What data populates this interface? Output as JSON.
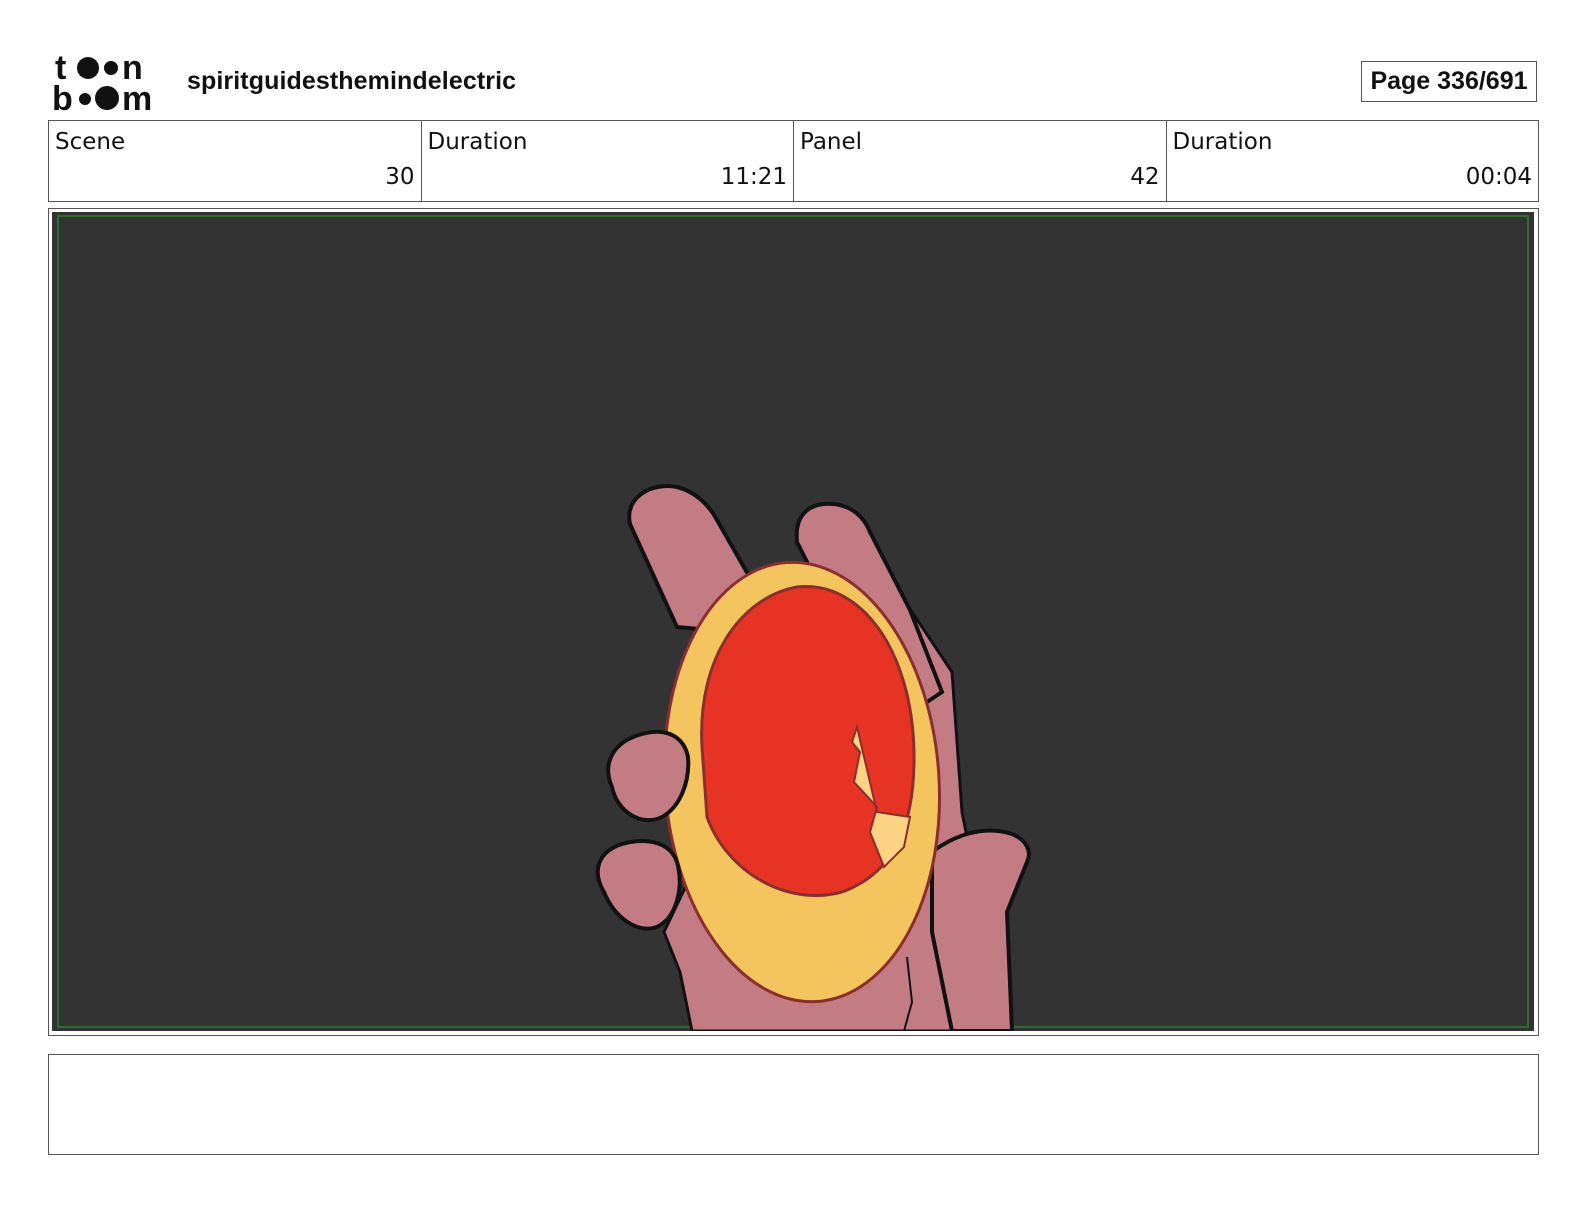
{
  "header": {
    "logo_lines": [
      "toon",
      "boom"
    ],
    "project_title": "spiritguidesthemindelectric",
    "page_label": "Page 336/691"
  },
  "info": {
    "scene_label": "Scene",
    "scene_value": "30",
    "scene_duration_label": "Duration",
    "scene_duration_value": "11:21",
    "panel_label": "Panel",
    "panel_value": "42",
    "panel_duration_label": "Duration",
    "panel_duration_value": "00:04"
  },
  "panel_image": {
    "icon": "hand-holding-egg-illustration",
    "colors": {
      "background": "#333333",
      "safe_frame": "#2e6b2e",
      "skin": "#c47c84",
      "egg_shell": "#f4c45e",
      "egg_yolk": "#e63323",
      "highlight": "#fbd383",
      "outline": "#111111"
    }
  },
  "notes": {
    "text": ""
  }
}
